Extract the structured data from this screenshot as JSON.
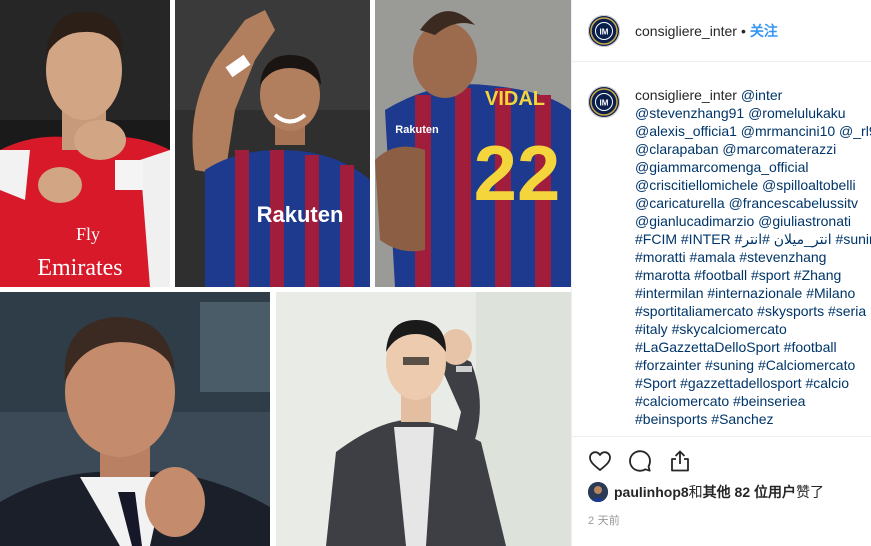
{
  "header": {
    "username": "consigliere_inter",
    "separator": "•",
    "follow_label": "关注"
  },
  "caption": {
    "username": "consigliere_inter",
    "lines": [
      [
        {
          "t": "@inter",
          "tag": true
        }
      ],
      [
        {
          "t": "@stevenzhang91",
          "tag": true
        },
        {
          "t": " ",
          "tag": false
        },
        {
          "t": "@romelulukaku",
          "tag": true
        }
      ],
      [
        {
          "t": "@alexis_officia1",
          "tag": true
        },
        {
          "t": " ",
          "tag": false
        },
        {
          "t": "@mrmancini10",
          "tag": true
        },
        {
          "t": " ",
          "tag": false
        },
        {
          "t": "@_rl9",
          "tag": true
        }
      ],
      [
        {
          "t": "@clarapaban",
          "tag": true
        },
        {
          "t": " ",
          "tag": false
        },
        {
          "t": "@marcomaterazzi",
          "tag": true
        }
      ],
      [
        {
          "t": "@giammarcomenga_official",
          "tag": true
        }
      ],
      [
        {
          "t": "@criscitiellomichele",
          "tag": true
        },
        {
          "t": " ",
          "tag": false
        },
        {
          "t": "@spilloaltobelli",
          "tag": true
        }
      ],
      [
        {
          "t": "@caricaturella",
          "tag": true
        },
        {
          "t": " ",
          "tag": false
        },
        {
          "t": "@francescabelussitv",
          "tag": true
        }
      ],
      [
        {
          "t": "@gianlucadimarzio",
          "tag": true
        },
        {
          "t": " ",
          "tag": false
        },
        {
          "t": "@giuliastronati",
          "tag": true
        }
      ],
      [
        {
          "t": "#FCIM #INTER #انتر_ميلان #انتر",
          "tag": true
        },
        {
          "t": " ",
          "tag": false
        },
        {
          "t": "#suning",
          "tag": true
        }
      ],
      [
        {
          "t": "#moratti",
          "tag": true
        },
        {
          "t": " ",
          "tag": false
        },
        {
          "t": "#amala",
          "tag": true
        },
        {
          "t": " ",
          "tag": false
        },
        {
          "t": "#stevenzhang",
          "tag": true
        }
      ],
      [
        {
          "t": "#marotta",
          "tag": true
        },
        {
          "t": " ",
          "tag": false
        },
        {
          "t": "#football",
          "tag": true
        },
        {
          "t": " ",
          "tag": false
        },
        {
          "t": "#sport",
          "tag": true
        },
        {
          "t": " ",
          "tag": false
        },
        {
          "t": "#Zhang",
          "tag": true
        }
      ],
      [
        {
          "t": "#intermilan",
          "tag": true
        },
        {
          "t": " ",
          "tag": false
        },
        {
          "t": "#internazionale",
          "tag": true
        },
        {
          "t": " ",
          "tag": false
        },
        {
          "t": "#Milano",
          "tag": true
        }
      ],
      [
        {
          "t": "#sportitaliamercato",
          "tag": true
        },
        {
          "t": " ",
          "tag": false
        },
        {
          "t": "#skysports",
          "tag": true
        },
        {
          "t": " ",
          "tag": false
        },
        {
          "t": "#seria",
          "tag": true
        }
      ],
      [
        {
          "t": "#italy",
          "tag": true
        },
        {
          "t": " ",
          "tag": false
        },
        {
          "t": "#skycalciomercato",
          "tag": true
        }
      ],
      [
        {
          "t": "#LaGazzettaDelloSport",
          "tag": true
        },
        {
          "t": " ",
          "tag": false
        },
        {
          "t": "#football",
          "tag": true
        }
      ],
      [
        {
          "t": "#forzainter",
          "tag": true
        },
        {
          "t": " ",
          "tag": false
        },
        {
          "t": "#suning",
          "tag": true
        },
        {
          "t": " ",
          "tag": false
        },
        {
          "t": "#Calciomercato",
          "tag": true
        }
      ],
      [
        {
          "t": "#Sport",
          "tag": true
        },
        {
          "t": " ",
          "tag": false
        },
        {
          "t": "#gazzettadellosport",
          "tag": true
        },
        {
          "t": " ",
          "tag": false
        },
        {
          "t": "#calcio",
          "tag": true
        }
      ],
      [
        {
          "t": "#calciomercato",
          "tag": true
        },
        {
          "t": " ",
          "tag": false
        },
        {
          "t": "#beinseriea",
          "tag": true
        }
      ],
      [
        {
          "t": "#beinsports",
          "tag": true
        },
        {
          "t": " ",
          "tag": false
        },
        {
          "t": "#Sanchez",
          "tag": true
        }
      ]
    ]
  },
  "likes": {
    "liker": "paulinhop8",
    "and": " 和 ",
    "others": "其他 82 位用户",
    "suffix": " 赞了"
  },
  "timestamp": "2 天前",
  "images": {
    "t1": {
      "sponsor_line1": "Fly",
      "sponsor_line2": "Emirates"
    },
    "t2": {
      "sponsor": "Rakuten"
    },
    "t3": {
      "shirt_name": "VIDAL",
      "shirt_number": "22",
      "maker": "Rakuten"
    }
  },
  "colors": {
    "link": "#003569",
    "follow": "#3897f0",
    "muted": "#999999",
    "text": "#262626",
    "arsenal_red": "#d7192a",
    "barca_blue": "#1d3a8f",
    "barca_garnet": "#a11d3c",
    "inter_navy": "#0b1f4d"
  },
  "icons": [
    "heart-icon",
    "comment-icon",
    "share-icon",
    "inter-logo-icon"
  ]
}
